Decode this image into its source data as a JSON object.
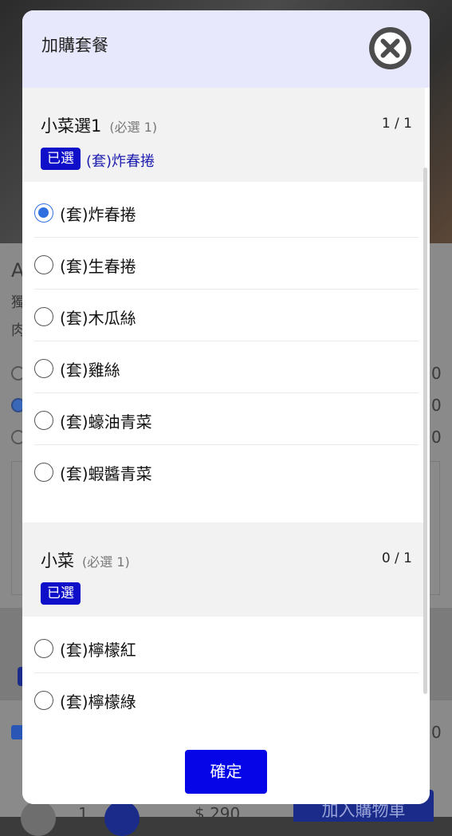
{
  "background": {
    "title_initial": "A",
    "desc_line1": "獨",
    "desc_line2": "肉",
    "right_edge_1": "0",
    "right_edge_2": "0",
    "right_edge_3": "0",
    "right_edge_4": "0",
    "qty": "1",
    "price": "$ 290",
    "add_to_cart_label": "加入購物車"
  },
  "modal": {
    "title": "加購套餐",
    "confirm_label": "確定",
    "groups": [
      {
        "title": "小菜選1",
        "requirement": "(必選 1)",
        "count": "1 / 1",
        "badge": "已選",
        "selected": "(套)炸春捲",
        "options": [
          {
            "label": "(套)炸春捲",
            "checked": true
          },
          {
            "label": "(套)生春捲",
            "checked": false
          },
          {
            "label": "(套)木瓜絲",
            "checked": false
          },
          {
            "label": "(套)雞絲",
            "checked": false
          },
          {
            "label": "(套)蠔油青菜",
            "checked": false
          },
          {
            "label": "(套)蝦醬青菜",
            "checked": false
          }
        ]
      },
      {
        "title": "小菜",
        "requirement": "(必選 1)",
        "count": "0 / 1",
        "badge": "已選",
        "selected": "",
        "options": [
          {
            "label": "(套)檸檬紅",
            "checked": false
          },
          {
            "label": "(套)檸檬綠",
            "checked": false
          }
        ]
      }
    ]
  },
  "colors": {
    "header_bg": "#e8e8fc",
    "accent_blue": "#0505e8",
    "badge_blue": "#0f0fc9",
    "radio_checked": "#2f6fe0"
  }
}
